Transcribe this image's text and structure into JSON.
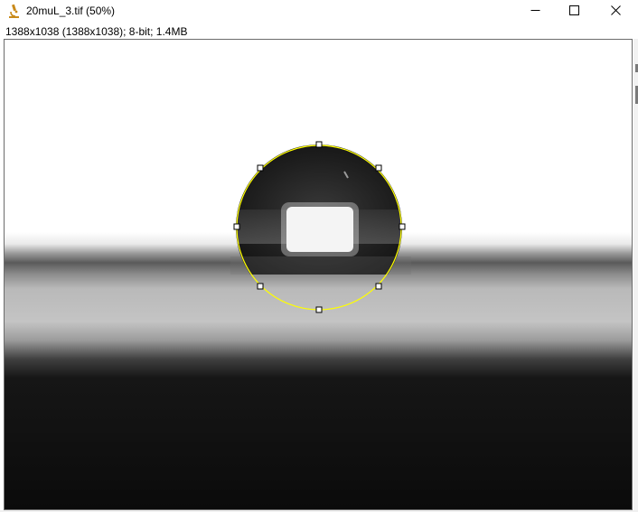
{
  "window": {
    "title": "20muL_3.tif (50%)",
    "icon": "microscope-icon",
    "controls": [
      "minimize-icon",
      "maximize-icon",
      "close-icon"
    ]
  },
  "image_info": "1388x1038   (1388x1038); 8-bit; 1.4MB",
  "overlay": {
    "shape": "oval-roi",
    "color": "#ffff00",
    "handle_count": 8
  },
  "colors": {
    "roi": "#ffff00",
    "frame_border": "#6c6c6c"
  }
}
